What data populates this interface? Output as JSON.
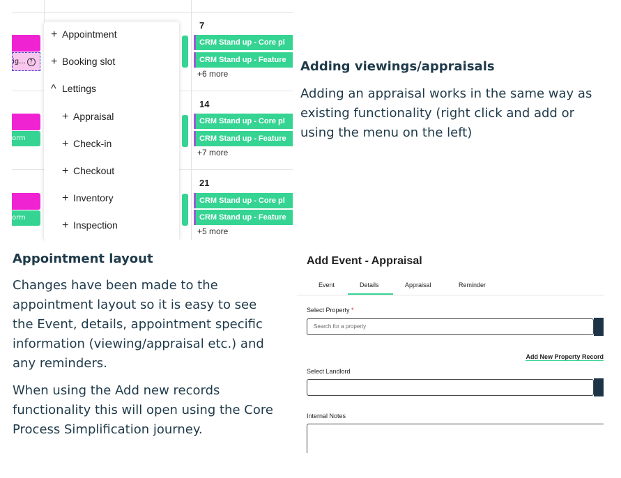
{
  "calendar": {
    "weeks": [
      {
        "day": "7",
        "events": [
          "CRM Stand up - Core pl",
          "CRM Stand up - Feature"
        ],
        "more": "+6 more"
      },
      {
        "day": "14",
        "events": [
          "CRM Stand up - Core pl",
          "CRM Stand up - Feature"
        ],
        "more": "+7 more"
      },
      {
        "day": "21",
        "events": [
          "CRM Stand up - Core pl",
          "CRM Stand up - Feature"
        ],
        "more": "+5 more"
      }
    ],
    "left_fragments": {
      "selected_text": "ig...",
      "q_icon": "?",
      "green_text": "orm"
    },
    "menu": {
      "items": [
        {
          "symbol": "+",
          "label": "Appointment"
        },
        {
          "symbol": "+",
          "label": "Booking slot"
        },
        {
          "symbol": "^",
          "label": "Lettings"
        }
      ],
      "sub_items": [
        {
          "symbol": "+",
          "label": "Appraisal"
        },
        {
          "symbol": "+",
          "label": "Check-in"
        },
        {
          "symbol": "+",
          "label": "Checkout"
        },
        {
          "symbol": "+",
          "label": "Inventory"
        },
        {
          "symbol": "+",
          "label": "Inspection"
        }
      ]
    }
  },
  "section_viewings": {
    "heading": "Adding viewings/appraisals",
    "lines": [
      "Adding an appraisal works in the same way as",
      "existing functionality (right click and add or",
      "using the menu on the left)"
    ]
  },
  "section_layout": {
    "heading": "Appointment layout",
    "para1": [
      "Changes have been made to the",
      "appointment layout so it is easy to see",
      "the Event, details, appointment specific",
      "information (viewing/appraisal etc.) and",
      "any reminders."
    ],
    "para2": [
      "When using the Add new records",
      "functionality this will open using the Core",
      "Process Simplification journey."
    ]
  },
  "form": {
    "title": "Add Event - Appraisal",
    "tabs": [
      "Event",
      "Details",
      "Appraisal",
      "Reminder"
    ],
    "active_tab": "Details",
    "select_property_label": "Select Property",
    "required_mark": "*",
    "property_placeholder": "Search for a property",
    "add_property_link": "Add New Property Record",
    "select_landlord_label": "Select Landlord",
    "internal_notes_label": "Internal Notes"
  },
  "colors": {
    "accent_green": "#35d493",
    "accent_pink": "#f023d3",
    "event_border_purple": "#9b59d6",
    "heading_text": "#1f3a4a",
    "dark_button": "#1d3446"
  }
}
